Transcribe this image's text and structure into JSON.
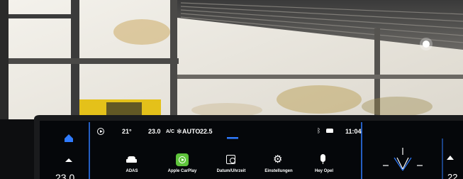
{
  "status_bar": {
    "temp_outside": "21°",
    "cabin_temp_left": "23.0",
    "ac_label": "A/C",
    "fan_mode": "AUTO",
    "cabin_temp_right": "22.5",
    "clock": "11:04"
  },
  "tiles": [
    {
      "label": "ADAS",
      "icon": "car-icon"
    },
    {
      "label": "Apple CarPlay",
      "icon": "carplay-icon"
    },
    {
      "label": "Datum/Uhrzeit",
      "icon": "calendar-clock-icon"
    },
    {
      "label": "Einstellungen",
      "icon": "gear-icon"
    },
    {
      "label": "Hey Opel",
      "icon": "microphone-icon"
    }
  ],
  "left_panel": {
    "temp_partial": "23.0"
  },
  "right_panel": {
    "temp_partial": "22"
  },
  "colors": {
    "accent_blue": "#2f7bff",
    "carplay_green": "#5ec43b",
    "screen_bg": "#05070a"
  }
}
